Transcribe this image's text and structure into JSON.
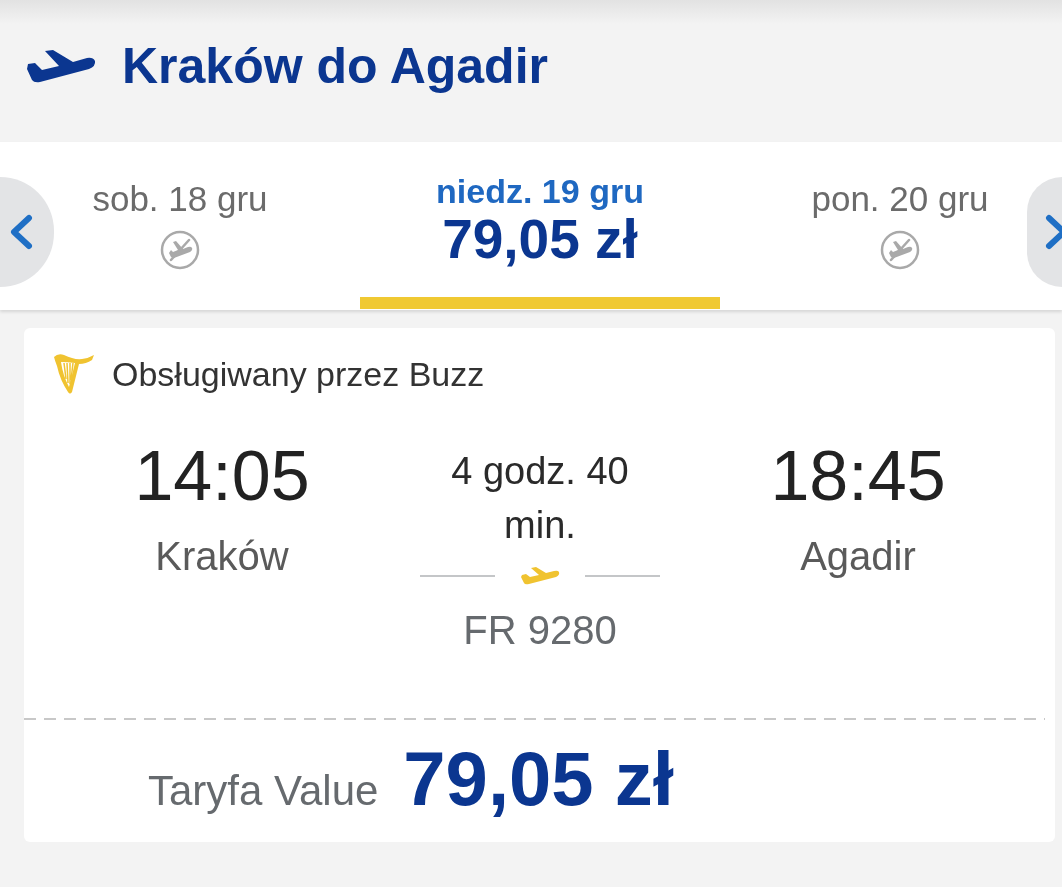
{
  "header": {
    "title": "Kraków do Agadir"
  },
  "date_strip": {
    "days": [
      {
        "date": "sob. 18 gru",
        "selected": false,
        "available": false
      },
      {
        "date": "niedz. 19 gru",
        "selected": true,
        "available": true,
        "price": "79,05 zł"
      },
      {
        "date": "pon. 20 gru",
        "selected": false,
        "available": false
      }
    ]
  },
  "flight": {
    "operator": "Obsługiwany przez Buzz",
    "departure": {
      "time": "14:05",
      "city": "Kraków"
    },
    "duration": "4 godz. 40 min.",
    "flight_number": "FR 9280",
    "arrival": {
      "time": "18:45",
      "city": "Agadir"
    },
    "fare": {
      "name": "Taryfa Value",
      "price": "79,05 zł"
    }
  }
}
